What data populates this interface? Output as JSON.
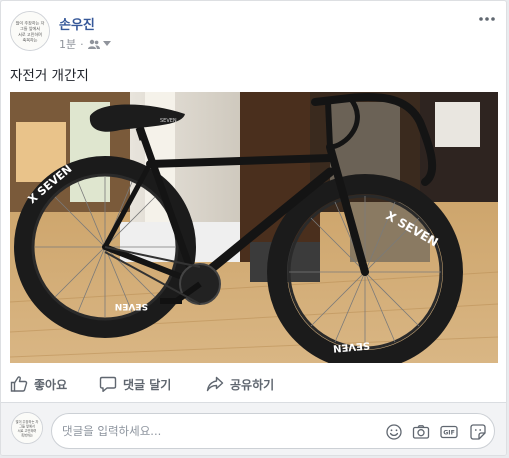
{
  "post": {
    "author": "손우진",
    "time": "1분",
    "separator": "·",
    "audience_icon": "friends-icon",
    "text": "자전거 개간지",
    "avatar_text": [
      "많이 주장하는 자",
      "그들 앞에서",
      "서로 고민하며",
      "축복하는"
    ],
    "photo": {
      "wheel_brand_front": "X SEVEN",
      "wheel_brand_rear": "X SEVEN",
      "wheel_side_text": "SEVEN",
      "saddle_text": "SEVEN"
    }
  },
  "actions": {
    "like": "좋아요",
    "comment": "댓글 달기",
    "share": "공유하기"
  },
  "composer": {
    "placeholder": "댓글을 입력하세요...",
    "gif_label": "GIF",
    "icons": [
      "emoji-icon",
      "camera-icon",
      "gif-icon",
      "sticker-icon"
    ]
  },
  "colors": {
    "author": "#365899",
    "meta": "#90949c",
    "action_text": "#606770",
    "composer_bg": "#f2f3f5"
  }
}
